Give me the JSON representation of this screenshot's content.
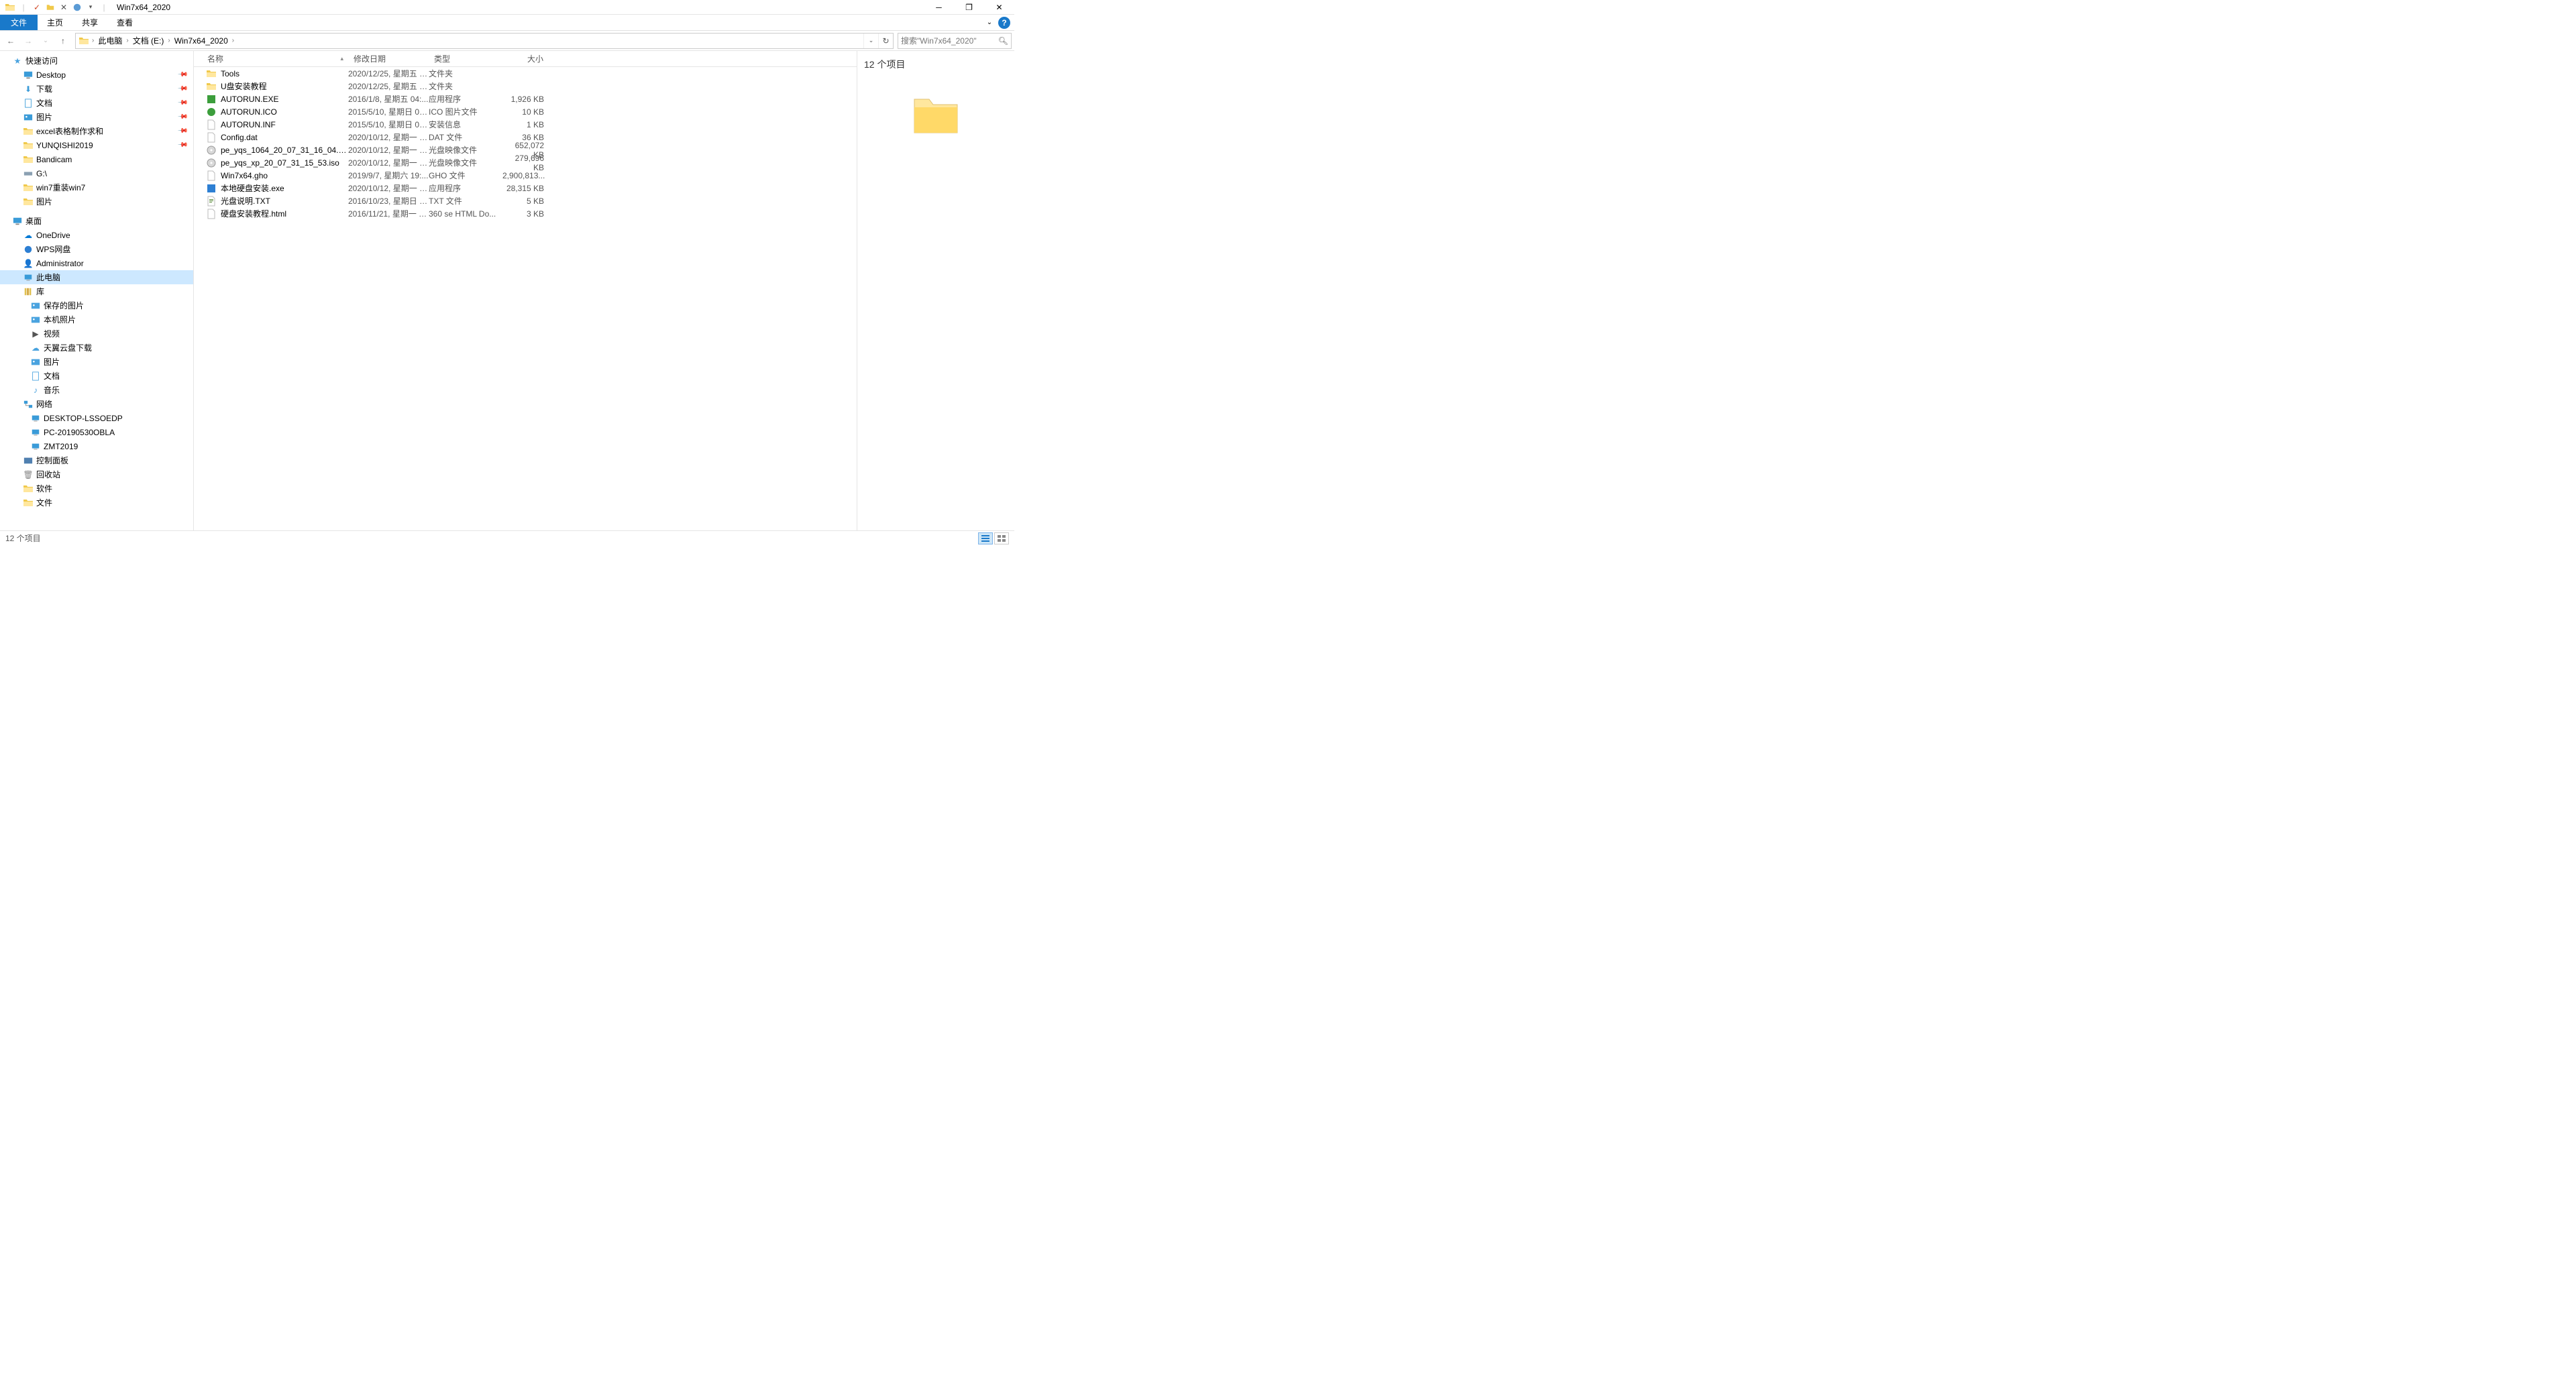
{
  "window": {
    "title": "Win7x64_2020"
  },
  "ribbon": {
    "file": "文件",
    "home": "主页",
    "share": "共享",
    "view": "查看"
  },
  "nav": {
    "crumbs": [
      "此电脑",
      "文档 (E:)",
      "Win7x64_2020"
    ],
    "search_placeholder": "搜索\"Win7x64_2020\""
  },
  "tree": [
    {
      "indent": 18,
      "icon": "star",
      "color": "#4aa3df",
      "label": "快速访问",
      "pin": false
    },
    {
      "indent": 34,
      "icon": "desktop",
      "color": "#3a9bd8",
      "label": "Desktop",
      "pin": true
    },
    {
      "indent": 34,
      "icon": "download",
      "color": "#3a9bd8",
      "label": "下载",
      "pin": true
    },
    {
      "indent": 34,
      "icon": "doc",
      "color": "#3a9bd8",
      "label": "文档",
      "pin": true
    },
    {
      "indent": 34,
      "icon": "pic",
      "color": "#3a9bd8",
      "label": "图片",
      "pin": true
    },
    {
      "indent": 34,
      "icon": "folder",
      "color": "#f0c94b",
      "label": "excel表格制作求和",
      "pin": true
    },
    {
      "indent": 34,
      "icon": "folder",
      "color": "#f0c94b",
      "label": "YUNQISHI2019",
      "pin": true
    },
    {
      "indent": 34,
      "icon": "folder",
      "color": "#f0c94b",
      "label": "Bandicam",
      "pin": false
    },
    {
      "indent": 34,
      "icon": "drive",
      "color": "#8aa0b2",
      "label": "G:\\",
      "pin": false
    },
    {
      "indent": 34,
      "icon": "folder",
      "color": "#f0c94b",
      "label": "win7重装win7",
      "pin": false
    },
    {
      "indent": 34,
      "icon": "folder",
      "color": "#f0c94b",
      "label": "图片",
      "pin": false
    },
    {
      "indent": 18,
      "icon": "desktop",
      "color": "#3a9bd8",
      "label": "桌面",
      "pin": false,
      "spaceBefore": true
    },
    {
      "indent": 34,
      "icon": "cloud",
      "color": "#0078d4",
      "label": "OneDrive",
      "pin": false
    },
    {
      "indent": 34,
      "icon": "wps",
      "color": "#2d7fd3",
      "label": "WPS网盘",
      "pin": false
    },
    {
      "indent": 34,
      "icon": "user",
      "color": "#e0a030",
      "label": "Administrator",
      "pin": false
    },
    {
      "indent": 34,
      "icon": "pc",
      "color": "#3a9bd8",
      "label": "此电脑",
      "pin": false,
      "selected": true
    },
    {
      "indent": 34,
      "icon": "lib",
      "color": "#e0c050",
      "label": "库",
      "pin": false
    },
    {
      "indent": 45,
      "icon": "pic",
      "color": "#4aa3df",
      "label": "保存的图片",
      "pin": false
    },
    {
      "indent": 45,
      "icon": "pic",
      "color": "#4aa3df",
      "label": "本机照片",
      "pin": false
    },
    {
      "indent": 45,
      "icon": "video",
      "color": "#555",
      "label": "视频",
      "pin": false
    },
    {
      "indent": 45,
      "icon": "cloud",
      "color": "#4aa3df",
      "label": "天翼云盘下载",
      "pin": false
    },
    {
      "indent": 45,
      "icon": "pic",
      "color": "#4aa3df",
      "label": "图片",
      "pin": false
    },
    {
      "indent": 45,
      "icon": "doc",
      "color": "#4aa3df",
      "label": "文档",
      "pin": false
    },
    {
      "indent": 45,
      "icon": "music",
      "color": "#4aa3df",
      "label": "音乐",
      "pin": false
    },
    {
      "indent": 34,
      "icon": "network",
      "color": "#3a9bd8",
      "label": "网络",
      "pin": false
    },
    {
      "indent": 45,
      "icon": "pc",
      "color": "#3a9bd8",
      "label": "DESKTOP-LSSOEDP",
      "pin": false
    },
    {
      "indent": 45,
      "icon": "pc",
      "color": "#3a9bd8",
      "label": "PC-20190530OBLA",
      "pin": false
    },
    {
      "indent": 45,
      "icon": "pc",
      "color": "#3a9bd8",
      "label": "ZMT2019",
      "pin": false
    },
    {
      "indent": 34,
      "icon": "control",
      "color": "#5080b0",
      "label": "控制面板",
      "pin": false
    },
    {
      "indent": 34,
      "icon": "recycle",
      "color": "#888",
      "label": "回收站",
      "pin": false
    },
    {
      "indent": 34,
      "icon": "folder",
      "color": "#f0c94b",
      "label": "软件",
      "pin": false
    },
    {
      "indent": 34,
      "icon": "folder",
      "color": "#f0c94b",
      "label": "文件",
      "pin": false
    }
  ],
  "columns": {
    "name": "名称",
    "date": "修改日期",
    "type": "类型",
    "size": "大小"
  },
  "files": [
    {
      "icon": "folder",
      "name": "Tools",
      "date": "2020/12/25, 星期五 1...",
      "type": "文件夹",
      "size": ""
    },
    {
      "icon": "folder",
      "name": "U盘安装教程",
      "date": "2020/12/25, 星期五 1...",
      "type": "文件夹",
      "size": ""
    },
    {
      "icon": "exe-green",
      "name": "AUTORUN.EXE",
      "date": "2016/1/8, 星期五 04:...",
      "type": "应用程序",
      "size": "1,926 KB"
    },
    {
      "icon": "ico-green",
      "name": "AUTORUN.ICO",
      "date": "2015/5/10, 星期日 02...",
      "type": "ICO 图片文件",
      "size": "10 KB"
    },
    {
      "icon": "inf",
      "name": "AUTORUN.INF",
      "date": "2015/5/10, 星期日 02...",
      "type": "安装信息",
      "size": "1 KB"
    },
    {
      "icon": "dat",
      "name": "Config.dat",
      "date": "2020/10/12, 星期一 1...",
      "type": "DAT 文件",
      "size": "36 KB"
    },
    {
      "icon": "iso",
      "name": "pe_yqs_1064_20_07_31_16_04.iso",
      "date": "2020/10/12, 星期一 1...",
      "type": "光盘映像文件",
      "size": "652,072 KB"
    },
    {
      "icon": "iso",
      "name": "pe_yqs_xp_20_07_31_15_53.iso",
      "date": "2020/10/12, 星期一 1...",
      "type": "光盘映像文件",
      "size": "279,696 KB"
    },
    {
      "icon": "gho",
      "name": "Win7x64.gho",
      "date": "2019/9/7, 星期六 19:...",
      "type": "GHO 文件",
      "size": "2,900,813..."
    },
    {
      "icon": "exe-blue",
      "name": "本地硬盘安装.exe",
      "date": "2020/10/12, 星期一 1...",
      "type": "应用程序",
      "size": "28,315 KB"
    },
    {
      "icon": "txt",
      "name": "光盘说明.TXT",
      "date": "2016/10/23, 星期日 0...",
      "type": "TXT 文件",
      "size": "5 KB"
    },
    {
      "icon": "html",
      "name": "硬盘安装教程.html",
      "date": "2016/11/21, 星期一 2...",
      "type": "360 se HTML Do...",
      "size": "3 KB"
    }
  ],
  "preview": {
    "title": "12 个项目"
  },
  "status": {
    "text": "12 个项目"
  }
}
